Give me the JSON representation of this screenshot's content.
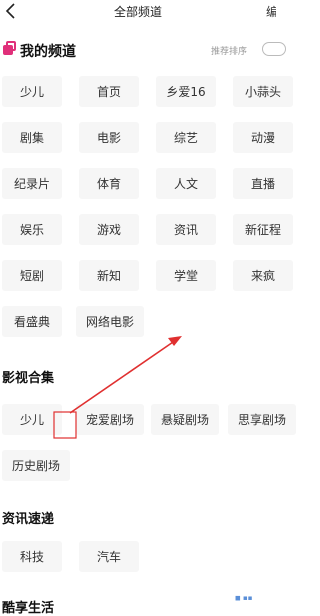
{
  "header": {
    "title": "全部频道",
    "edit_label": "编辑"
  },
  "my_channels": {
    "title": "我的频道",
    "sort_hint": "推荐排序",
    "items": [
      "少儿",
      "首页",
      "乡爱16",
      "小蒜头",
      "剧集",
      "电影",
      "综艺",
      "动漫",
      "纪录片",
      "体育",
      "人文",
      "直播",
      "娱乐",
      "游戏",
      "资讯",
      "新征程",
      "短剧",
      "新知",
      "学堂",
      "来疯",
      "看盛典",
      "网络电影"
    ]
  },
  "film_collection": {
    "title": "影视合集",
    "items": [
      "少儿",
      "宠爱剧场",
      "悬疑剧场",
      "思享剧场",
      "历史剧场"
    ]
  },
  "news_express": {
    "title": "资讯速递",
    "items": [
      "科技",
      "汽车"
    ]
  },
  "cool_life": {
    "title": "酷享生活"
  },
  "colors": {
    "accent": "#e0307a",
    "annotation": "#e03030",
    "chip_bg": "#f6f6f6"
  },
  "icons": {
    "back": "back-arrow-icon",
    "my_channel": "channel-stack-icon",
    "toggle": "toggle-switch"
  }
}
